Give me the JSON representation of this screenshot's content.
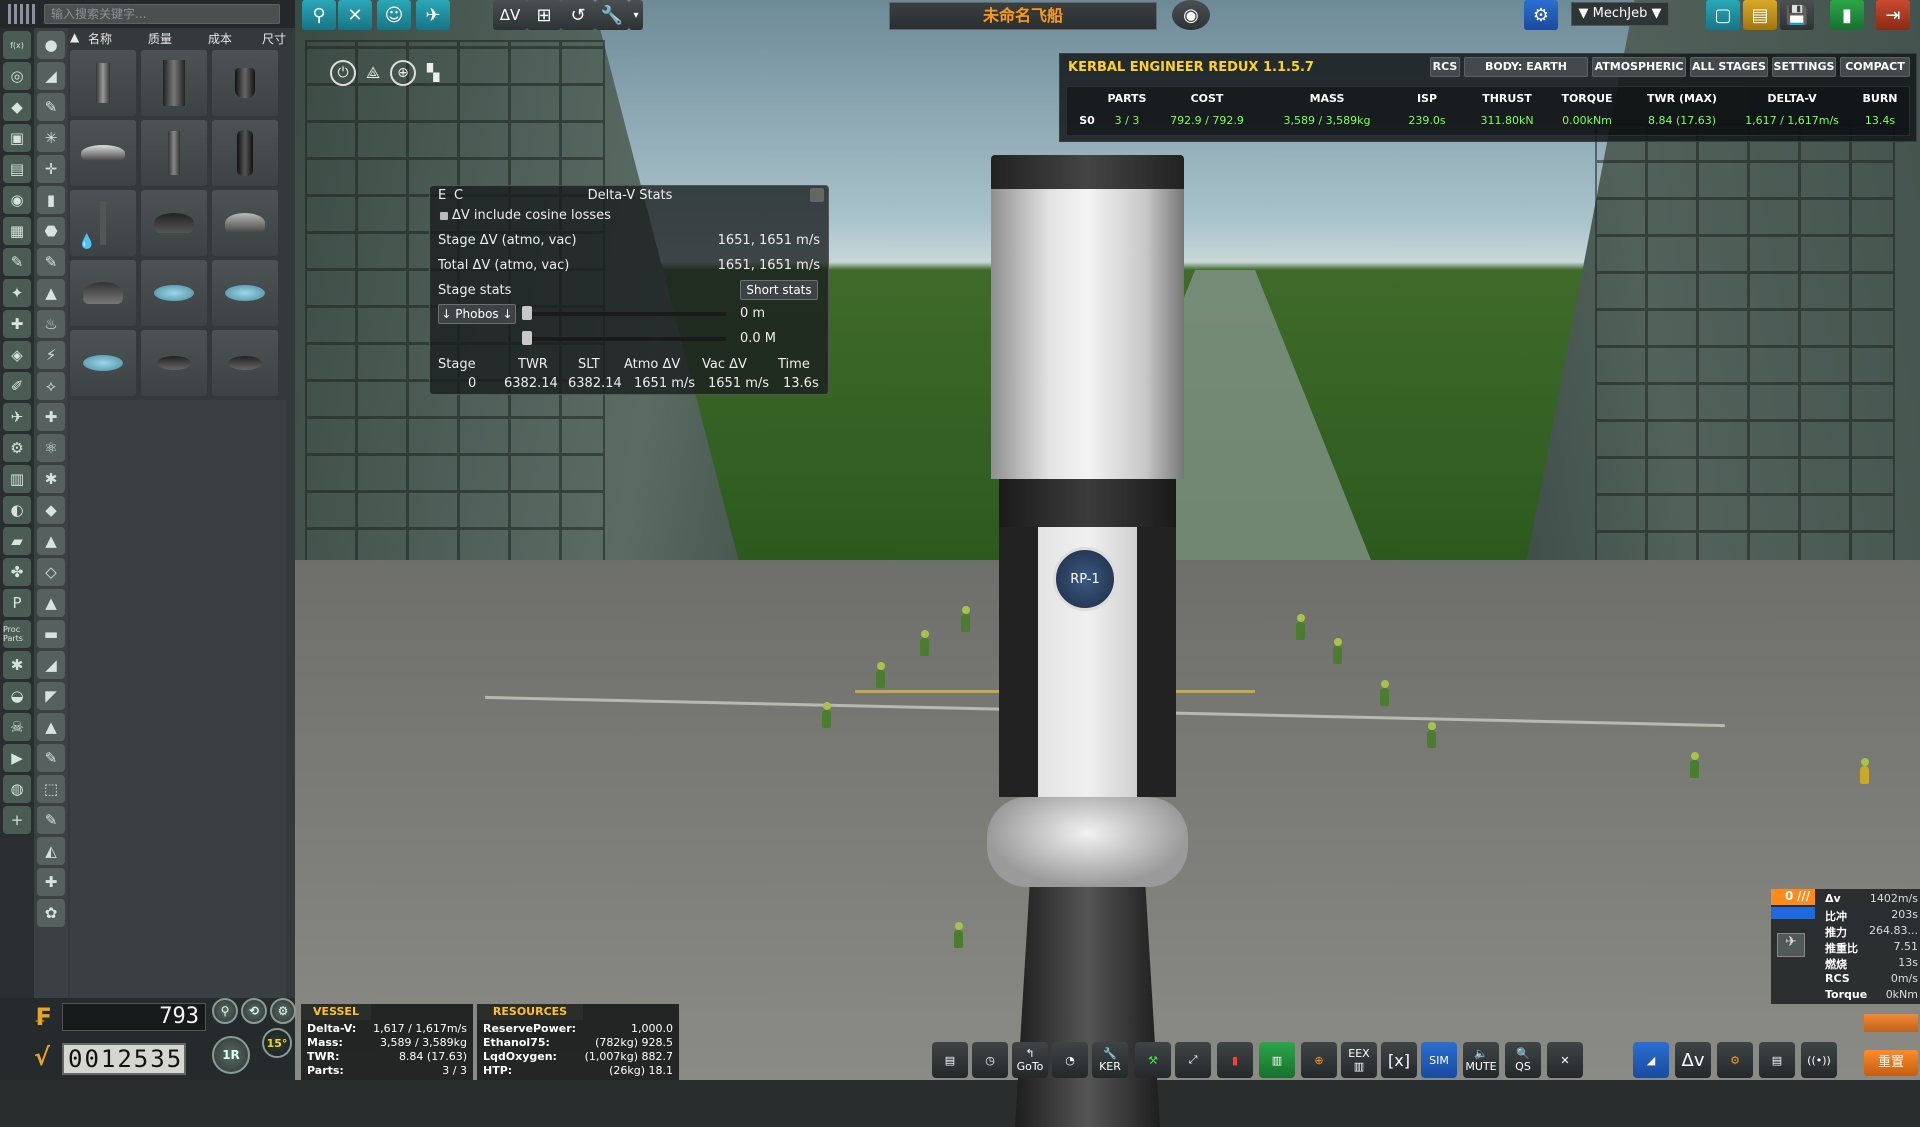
{
  "search": {
    "placeholder": "输入搜索关键字..."
  },
  "parts_list": {
    "columns": [
      "名称",
      "质量",
      "成本",
      "尺寸"
    ]
  },
  "categories_col1": [
    "f(x)",
    "◎",
    "◆",
    "▣",
    "▤",
    "◉",
    "▦",
    "✎",
    "✦",
    "✚",
    "◈",
    "✐",
    "✈",
    "⚙",
    "▥",
    "◐",
    "▰",
    "✤",
    "P",
    "Proc Parts",
    "✱",
    "◒",
    "☠",
    "▶",
    "◍",
    "+"
  ],
  "categories_col2": [
    "●",
    "◢",
    "✎",
    "✳",
    "✛",
    "▮",
    "⬣",
    "✎",
    "▲",
    "♨",
    "⚡",
    "⟡",
    "✚",
    "⚛",
    "✱",
    "◆",
    "▲",
    "◇",
    "▲",
    "▬",
    "◢",
    "◤",
    "▲",
    "✎",
    "⬚",
    "✎",
    "◭",
    "✚",
    "✿"
  ],
  "ship": {
    "name": "未命名飞船"
  },
  "toolbar": {
    "mechjeb_label": "▼ MechJeb ▼",
    "dv_label": "ΔV"
  },
  "ker": {
    "title": "KERBAL ENGINEER REDUX 1.1.5.7",
    "tabs": [
      "RCS",
      "BODY: EARTH",
      "ATMOSPHERIC",
      "ALL STAGES",
      "SETTINGS",
      "COMPACT"
    ],
    "headers": [
      "PARTS",
      "COST",
      "MASS",
      "ISP",
      "THRUST",
      "TORQUE",
      "TWR (MAX)",
      "DELTA-V",
      "BURN"
    ],
    "stage_label": "S0",
    "values": [
      "3 / 3",
      "792.9 / 792.9",
      "3,589 / 3,589kg",
      "239.0s",
      "311.80kN",
      "0.00kNm",
      "8.84 (17.63)",
      "1,617 / 1,617m/s",
      "13.4s"
    ]
  },
  "dv_window": {
    "corner_e": "E",
    "corner_c": "C",
    "title": "Delta-V Stats",
    "cosine_label": "ΔV include cosine losses",
    "stage_dv_label": "Stage ΔV (atmo, vac)",
    "stage_dv_value": "1651, 1651 m/s",
    "total_dv_label": "Total ΔV (atmo, vac)",
    "total_dv_value": "1651, 1651 m/s",
    "stage_stats_label": "Stage stats",
    "short_stats_button": "Short stats",
    "body_button": "↓ Phobos ↓",
    "altitude_value": "0 m",
    "mach_value": "0.0 M",
    "table_headers": [
      "Stage",
      "TWR",
      "SLT",
      "Atmo ΔV",
      "Vac ΔV",
      "Time"
    ],
    "table_row": [
      "0",
      "6382.14",
      "6382.14",
      "1651 m/s",
      "1651 m/s",
      "13.6s"
    ]
  },
  "vessel": {
    "tab": "VESSEL",
    "rows": [
      {
        "k": "Delta-V:",
        "v": "1,617 / 1,617m/s"
      },
      {
        "k": "Mass:",
        "v": "3,589 / 3,589kg"
      },
      {
        "k": "TWR:",
        "v": "8.84 (17.63)"
      },
      {
        "k": "Parts:",
        "v": "3 / 3"
      }
    ]
  },
  "resources": {
    "tab": "RESOURCES",
    "rows": [
      {
        "k": "ReservePower:",
        "v": "1,000.0"
      },
      {
        "k": "Ethanol75:",
        "v": "(782kg) 928.5"
      },
      {
        "k": "LqdOxygen:",
        "v": "(1,007kg) 882.7"
      },
      {
        "k": "HTP:",
        "v": "(26kg) 18.1"
      }
    ]
  },
  "counters": {
    "funds": "793",
    "cost": "0012535",
    "rotation_label": "1R",
    "angle_label": "15°"
  },
  "bottom_toolbar": {
    "goto": "GoTo",
    "ker": "KER",
    "eex": "EEX",
    "mute": "MUTE",
    "qs": "QS",
    "x_label": "[x]",
    "sim": "SIM",
    "dv": "Δv",
    "reset": "重置"
  },
  "rdv": {
    "stage": "0",
    "rows": [
      {
        "k": "Δv",
        "v": "1402m/s"
      },
      {
        "k": "比冲",
        "v": "203s"
      },
      {
        "k": "推力",
        "v": "264.83..."
      },
      {
        "k": "推重比",
        "v": "7.51"
      },
      {
        "k": "燃烧",
        "v": "13s"
      },
      {
        "k": "RCS",
        "v": "0m/s"
      },
      {
        "k": "Torque",
        "v": "0kNm"
      }
    ]
  },
  "colors": {
    "accent_orange": "#ff9a17",
    "ker_yellow": "#ffd21f",
    "ker_green": "#7fff5a",
    "teal": "#2aa7b8"
  }
}
